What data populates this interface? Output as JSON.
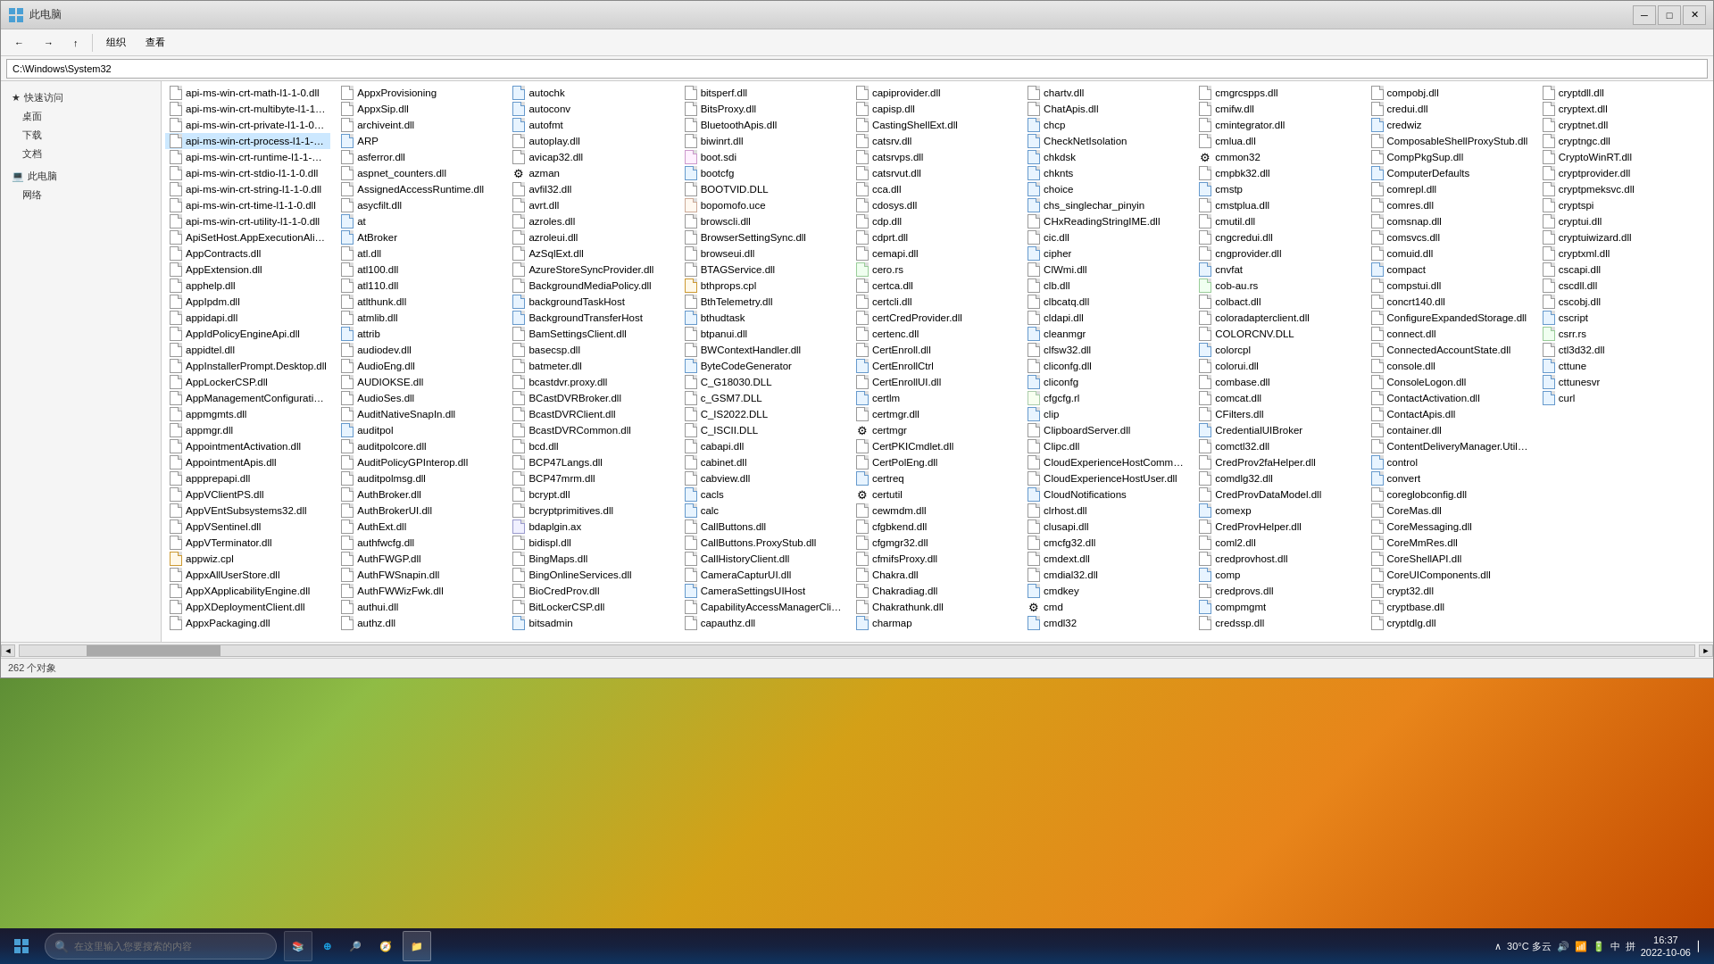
{
  "window": {
    "title": "此电脑",
    "address": "C:\\Windows\\System32"
  },
  "toolbar": {
    "back_label": "←",
    "forward_label": "→",
    "up_label": "↑",
    "view_label": "查看",
    "organize_label": "组织"
  },
  "search": {
    "placeholder": "在这里输入您要搜索的内容"
  },
  "files": [
    {
      "name": "api-ms-win-crt-math-l1-1-0.dll",
      "type": "dll"
    },
    {
      "name": "api-ms-win-crt-multibyte-l1-1-0.dll",
      "type": "dll"
    },
    {
      "name": "api-ms-win-crt-private-l1-1-0.dll",
      "type": "dll"
    },
    {
      "name": "api-ms-win-crt-process-l1-1-0.dll",
      "type": "dll",
      "selected": true
    },
    {
      "name": "api-ms-win-crt-runtime-l1-1-0.dll",
      "type": "dll"
    },
    {
      "name": "api-ms-win-crt-stdio-l1-1-0.dll",
      "type": "dll"
    },
    {
      "name": "api-ms-win-crt-string-l1-1-0.dll",
      "type": "dll"
    },
    {
      "name": "api-ms-win-crt-time-l1-1-0.dll",
      "type": "dll"
    },
    {
      "name": "api-ms-win-crt-utility-l1-1-0.dll",
      "type": "dll"
    },
    {
      "name": "ApiSetHost.AppExecutionAlias.dll",
      "type": "dll"
    },
    {
      "name": "AppContracts.dll",
      "type": "dll"
    },
    {
      "name": "AppExtension.dll",
      "type": "dll"
    },
    {
      "name": "apphelp.dll",
      "type": "dll"
    },
    {
      "name": "AppIpdm.dll",
      "type": "dll"
    },
    {
      "name": "appidapi.dll",
      "type": "dll"
    },
    {
      "name": "AppIdPolicyEngineApi.dll",
      "type": "dll"
    },
    {
      "name": "appidtel.dll",
      "type": "dll"
    },
    {
      "name": "AppInstallerPrompt.Desktop.dll",
      "type": "dll"
    },
    {
      "name": "AppLockerCSP.dll",
      "type": "dll"
    },
    {
      "name": "AppManagementConfiguration.dll",
      "type": "dll"
    },
    {
      "name": "appmgmts.dll",
      "type": "dll"
    },
    {
      "name": "appmgr.dll",
      "type": "dll"
    },
    {
      "name": "AppointmentActivation.dll",
      "type": "dll"
    },
    {
      "name": "AppointmentApis.dll",
      "type": "dll"
    },
    {
      "name": "appprepapi.dll",
      "type": "dll"
    },
    {
      "name": "AppVClientPS.dll",
      "type": "dll"
    },
    {
      "name": "AppVEntSubsystems32.dll",
      "type": "dll"
    },
    {
      "name": "AppVSentinel.dll",
      "type": "dll"
    },
    {
      "name": "AppVTerminator.dll",
      "type": "dll"
    },
    {
      "name": "appwiz.cpl",
      "type": "cpl"
    },
    {
      "name": "AppxAllUserStore.dll",
      "type": "dll"
    },
    {
      "name": "AppXApplicabilityEngine.dll",
      "type": "dll"
    },
    {
      "name": "AppXDeploymentClient.dll",
      "type": "dll"
    },
    {
      "name": "AppxPackaging.dll",
      "type": "dll"
    },
    {
      "name": "AppxProvisioning",
      "type": "dll"
    },
    {
      "name": "AppxSip.dll",
      "type": "dll"
    },
    {
      "name": "archiveint.dll",
      "type": "dll"
    },
    {
      "name": "ARP",
      "type": "exe"
    },
    {
      "name": "asferror.dll",
      "type": "dll"
    },
    {
      "name": "aspnet_counters.dll",
      "type": "dll"
    },
    {
      "name": "AssignedAccessRuntime.dll",
      "type": "dll"
    },
    {
      "name": "asycfilt.dll",
      "type": "dll"
    },
    {
      "name": "at",
      "type": "exe"
    },
    {
      "name": "AtBroker",
      "type": "exe"
    },
    {
      "name": "atl.dll",
      "type": "dll"
    },
    {
      "name": "atl100.dll",
      "type": "dll"
    },
    {
      "name": "atl110.dll",
      "type": "dll"
    },
    {
      "name": "atlthunk.dll",
      "type": "dll"
    },
    {
      "name": "atmlib.dll",
      "type": "dll"
    },
    {
      "name": "attrib",
      "type": "exe"
    },
    {
      "name": "audiodev.dll",
      "type": "dll"
    },
    {
      "name": "AudioEng.dll",
      "type": "dll"
    },
    {
      "name": "AUDIOKSE.dll",
      "type": "dll"
    },
    {
      "name": "AudioSes.dll",
      "type": "dll"
    },
    {
      "name": "AuditNativeSnapIn.dll",
      "type": "dll"
    },
    {
      "name": "auditpol",
      "type": "exe"
    },
    {
      "name": "auditpolcore.dll",
      "type": "dll"
    },
    {
      "name": "AuditPolicyGPInterop.dll",
      "type": "dll"
    },
    {
      "name": "auditpolmsg.dll",
      "type": "dll"
    },
    {
      "name": "AuthBroker.dll",
      "type": "dll"
    },
    {
      "name": "AuthBrokerUI.dll",
      "type": "dll"
    },
    {
      "name": "AuthExt.dll",
      "type": "dll"
    },
    {
      "name": "authfwcfg.dll",
      "type": "dll"
    },
    {
      "name": "AuthFWGP.dll",
      "type": "dll"
    },
    {
      "name": "AuthFWSnapin.dll",
      "type": "dll"
    },
    {
      "name": "AuthFWWizFwk.dll",
      "type": "dll"
    },
    {
      "name": "authui.dll",
      "type": "dll"
    },
    {
      "name": "authz.dll",
      "type": "dll"
    },
    {
      "name": "autochk",
      "type": "exe"
    },
    {
      "name": "autoconv",
      "type": "exe"
    },
    {
      "name": "autofmt",
      "type": "exe"
    },
    {
      "name": "autoplay.dll",
      "type": "dll"
    },
    {
      "name": "avicap32.dll",
      "type": "dll"
    },
    {
      "name": "azman",
      "type": "exe",
      "special": true
    },
    {
      "name": "avfil32.dll",
      "type": "dll"
    },
    {
      "name": "avrt.dll",
      "type": "dll"
    },
    {
      "name": "azroles.dll",
      "type": "dll"
    },
    {
      "name": "azroleui.dll",
      "type": "dll"
    },
    {
      "name": "AzSqlExt.dll",
      "type": "dll"
    },
    {
      "name": "AzureStoreSyncProvider.dll",
      "type": "dll"
    },
    {
      "name": "BackgroundMediaPolicy.dll",
      "type": "dll"
    },
    {
      "name": "backgroundTaskHost",
      "type": "exe"
    },
    {
      "name": "BackgroundTransferHost",
      "type": "exe"
    },
    {
      "name": "BamSettingsClient.dll",
      "type": "dll"
    },
    {
      "name": "basecsp.dll",
      "type": "dll"
    },
    {
      "name": "batmeter.dll",
      "type": "dll"
    },
    {
      "name": "bcastdvr.proxy.dll",
      "type": "dll"
    },
    {
      "name": "BCastDVRBroker.dll",
      "type": "dll"
    },
    {
      "name": "BcastDVRClient.dll",
      "type": "dll"
    },
    {
      "name": "BcastDVRCommon.dll",
      "type": "dll"
    },
    {
      "name": "bcd.dll",
      "type": "dll"
    },
    {
      "name": "BCP47Langs.dll",
      "type": "dll"
    },
    {
      "name": "BCP47mrm.dll",
      "type": "dll"
    },
    {
      "name": "bcrypt.dll",
      "type": "dll"
    },
    {
      "name": "bcryptprimitives.dll",
      "type": "dll"
    },
    {
      "name": "bdaplgin.ax",
      "type": "ax"
    },
    {
      "name": "bidispl.dll",
      "type": "dll"
    },
    {
      "name": "BingMaps.dll",
      "type": "dll"
    },
    {
      "name": "BingOnlineServices.dll",
      "type": "dll"
    },
    {
      "name": "BioCredProv.dll",
      "type": "dll"
    },
    {
      "name": "BitLockerCSP.dll",
      "type": "dll"
    },
    {
      "name": "bitsadmin",
      "type": "exe"
    },
    {
      "name": "bitsperf.dll",
      "type": "dll"
    },
    {
      "name": "BitsProxy.dll",
      "type": "dll"
    },
    {
      "name": "BluetoothApis.dll",
      "type": "dll"
    },
    {
      "name": "biwinrt.dll",
      "type": "dll"
    },
    {
      "name": "boot.sdi",
      "type": "sdi"
    },
    {
      "name": "bootcfg",
      "type": "exe"
    },
    {
      "name": "BOOTVID.DLL",
      "type": "dll"
    },
    {
      "name": "bopomofo.uce",
      "type": "uce"
    },
    {
      "name": "browscli.dll",
      "type": "dll"
    },
    {
      "name": "BrowserSettingSync.dll",
      "type": "dll"
    },
    {
      "name": "browseui.dll",
      "type": "dll"
    },
    {
      "name": "BTAGService.dll",
      "type": "dll"
    },
    {
      "name": "bthprops.cpl",
      "type": "cpl"
    },
    {
      "name": "BthTelemetry.dll",
      "type": "dll"
    },
    {
      "name": "bthudtask",
      "type": "exe"
    },
    {
      "name": "btpanui.dll",
      "type": "dll"
    },
    {
      "name": "BWContextHandler.dll",
      "type": "dll"
    },
    {
      "name": "ByteCodeGenerator",
      "type": "exe"
    },
    {
      "name": "C_G18030.DLL",
      "type": "dll"
    },
    {
      "name": "c_GSM7.DLL",
      "type": "dll"
    },
    {
      "name": "C_IS2022.DLL",
      "type": "dll"
    },
    {
      "name": "C_ISCII.DLL",
      "type": "dll"
    },
    {
      "name": "cabapi.dll",
      "type": "dll"
    },
    {
      "name": "cabinet.dll",
      "type": "dll"
    },
    {
      "name": "cabview.dll",
      "type": "dll"
    },
    {
      "name": "cacls",
      "type": "exe"
    },
    {
      "name": "calc",
      "type": "exe"
    },
    {
      "name": "CallButtons.dll",
      "type": "dll"
    },
    {
      "name": "CallButtons.ProxyStub.dll",
      "type": "dll"
    },
    {
      "name": "CallHistoryClient.dll",
      "type": "dll"
    },
    {
      "name": "CameraCapturUI.dll",
      "type": "dll"
    },
    {
      "name": "CameraSettingsUIHost",
      "type": "exe"
    },
    {
      "name": "CapabilityAccessManagerClient.dll",
      "type": "dll"
    },
    {
      "name": "capauthz.dll",
      "type": "dll"
    },
    {
      "name": "capiprovider.dll",
      "type": "dll"
    },
    {
      "name": "capisp.dll",
      "type": "dll"
    },
    {
      "name": "CastingShellExt.dll",
      "type": "dll"
    },
    {
      "name": "catsrv.dll",
      "type": "dll"
    },
    {
      "name": "catsrvps.dll",
      "type": "dll"
    },
    {
      "name": "catsrvut.dll",
      "type": "dll"
    },
    {
      "name": "cca.dll",
      "type": "dll"
    },
    {
      "name": "cdosys.dll",
      "type": "dll"
    },
    {
      "name": "cdp.dll",
      "type": "dll"
    },
    {
      "name": "cdprt.dll",
      "type": "dll"
    },
    {
      "name": "cemapi.dll",
      "type": "dll"
    },
    {
      "name": "cero.rs",
      "type": "rs"
    },
    {
      "name": "certca.dll",
      "type": "dll"
    },
    {
      "name": "certcli.dll",
      "type": "dll"
    },
    {
      "name": "certCredProvider.dll",
      "type": "dll"
    },
    {
      "name": "certenc.dll",
      "type": "dll"
    },
    {
      "name": "CertEnroll.dll",
      "type": "dll"
    },
    {
      "name": "CertEnrollCtrl",
      "type": "exe"
    },
    {
      "name": "CertEnrollUI.dll",
      "type": "dll"
    },
    {
      "name": "certlm",
      "type": "exe"
    },
    {
      "name": "certmgr.dll",
      "type": "dll"
    },
    {
      "name": "certmgr",
      "type": "exe",
      "special": true
    },
    {
      "name": "CertPKICmdlet.dll",
      "type": "dll"
    },
    {
      "name": "CertPolEng.dll",
      "type": "dll"
    },
    {
      "name": "certreq",
      "type": "exe"
    },
    {
      "name": "certutil",
      "type": "exe",
      "special": true
    },
    {
      "name": "cewmdm.dll",
      "type": "dll"
    },
    {
      "name": "cfgbkend.dll",
      "type": "dll"
    },
    {
      "name": "cfgmgr32.dll",
      "type": "dll"
    },
    {
      "name": "cfmifsProxy.dll",
      "type": "dll"
    },
    {
      "name": "Chakra.dll",
      "type": "dll"
    },
    {
      "name": "Chakradiag.dll",
      "type": "dll"
    },
    {
      "name": "Chakrathunk.dll",
      "type": "dll"
    },
    {
      "name": "charmap",
      "type": "exe"
    },
    {
      "name": "chartv.dll",
      "type": "dll"
    },
    {
      "name": "ChatApis.dll",
      "type": "dll"
    },
    {
      "name": "chcp",
      "type": "exe"
    },
    {
      "name": "CheckNetIsolation",
      "type": "exe"
    },
    {
      "name": "chkdsk",
      "type": "exe"
    },
    {
      "name": "chknts",
      "type": "exe"
    },
    {
      "name": "choice",
      "type": "exe"
    },
    {
      "name": "chs_singlechar_pinyin",
      "type": "exe"
    },
    {
      "name": "CHxReadingStringIME.dll",
      "type": "dll"
    },
    {
      "name": "cic.dll",
      "type": "dll"
    },
    {
      "name": "cipher",
      "type": "exe"
    },
    {
      "name": "ClWmi.dll",
      "type": "dll"
    },
    {
      "name": "clb.dll",
      "type": "dll"
    },
    {
      "name": "clbcatq.dll",
      "type": "dll"
    },
    {
      "name": "cldapi.dll",
      "type": "dll"
    },
    {
      "name": "cleanmgr",
      "type": "exe"
    },
    {
      "name": "clfsw32.dll",
      "type": "dll"
    },
    {
      "name": "cliconfg.dll",
      "type": "dll"
    },
    {
      "name": "cliconfg",
      "type": "exe"
    },
    {
      "name": "cfgcfg.rl",
      "type": "rl"
    },
    {
      "name": "clip",
      "type": "exe"
    },
    {
      "name": "ClipboardServer.dll",
      "type": "dll"
    },
    {
      "name": "Clipc.dll",
      "type": "dll"
    },
    {
      "name": "CloudExperienceHostCommon.dll",
      "type": "dll"
    },
    {
      "name": "CloudExperienceHostUser.dll",
      "type": "dll"
    },
    {
      "name": "CloudNotifications",
      "type": "exe"
    },
    {
      "name": "clrhost.dll",
      "type": "dll"
    },
    {
      "name": "clusapi.dll",
      "type": "dll"
    },
    {
      "name": "cmcfg32.dll",
      "type": "dll"
    },
    {
      "name": "cmdext.dll",
      "type": "dll"
    },
    {
      "name": "cmdial32.dll",
      "type": "dll"
    },
    {
      "name": "cmdkey",
      "type": "exe"
    },
    {
      "name": "cmd",
      "type": "exe",
      "special": true
    },
    {
      "name": "cmdl32",
      "type": "exe"
    },
    {
      "name": "cmgrcspps.dll",
      "type": "dll"
    },
    {
      "name": "cmifw.dll",
      "type": "dll"
    },
    {
      "name": "cmintegrator.dll",
      "type": "dll"
    },
    {
      "name": "cmlua.dll",
      "type": "dll"
    },
    {
      "name": "cmmon32",
      "type": "exe",
      "special": true
    },
    {
      "name": "cmpbk32.dll",
      "type": "dll"
    },
    {
      "name": "cmstp",
      "type": "exe"
    },
    {
      "name": "cmstplua.dll",
      "type": "dll"
    },
    {
      "name": "cmutil.dll",
      "type": "dll"
    },
    {
      "name": "cngcredui.dll",
      "type": "dll"
    },
    {
      "name": "cngprovider.dll",
      "type": "dll"
    },
    {
      "name": "cnvfat",
      "type": "exe"
    },
    {
      "name": "cob-au.rs",
      "type": "rs"
    },
    {
      "name": "colbact.dll",
      "type": "dll"
    },
    {
      "name": "coloradapterclient.dll",
      "type": "dll"
    },
    {
      "name": "COLORCNV.DLL",
      "type": "dll"
    },
    {
      "name": "colorcpl",
      "type": "exe"
    },
    {
      "name": "colorui.dll",
      "type": "dll"
    },
    {
      "name": "combase.dll",
      "type": "dll"
    },
    {
      "name": "comcat.dll",
      "type": "dll"
    },
    {
      "name": "CFilters.dll",
      "type": "dll"
    },
    {
      "name": "CredentialUIBroker",
      "type": "exe"
    },
    {
      "name": "comctl32.dll",
      "type": "dll"
    },
    {
      "name": "CredProv2faHelper.dll",
      "type": "dll"
    },
    {
      "name": "comdlg32.dll",
      "type": "dll"
    },
    {
      "name": "CredProvDataModel.dll",
      "type": "dll"
    },
    {
      "name": "comexp",
      "type": "exe"
    },
    {
      "name": "CredProvHelper.dll",
      "type": "dll"
    },
    {
      "name": "coml2.dll",
      "type": "dll"
    },
    {
      "name": "credprovhost.dll",
      "type": "dll"
    },
    {
      "name": "comp",
      "type": "exe"
    },
    {
      "name": "credprovs.dll",
      "type": "dll"
    },
    {
      "name": "compmgmt",
      "type": "exe"
    },
    {
      "name": "credssp.dll",
      "type": "dll"
    },
    {
      "name": "compobj.dll",
      "type": "dll"
    },
    {
      "name": "credui.dll",
      "type": "dll"
    },
    {
      "name": "credwiz",
      "type": "exe"
    },
    {
      "name": "ComposableShellProxyStub.dll",
      "type": "dll"
    },
    {
      "name": "CompPkgSup.dll",
      "type": "dll"
    },
    {
      "name": "ComputerDefaults",
      "type": "exe"
    },
    {
      "name": "comrepl.dll",
      "type": "dll"
    },
    {
      "name": "comres.dll",
      "type": "dll"
    },
    {
      "name": "comsnap.dll",
      "type": "dll"
    },
    {
      "name": "comsvcs.dll",
      "type": "dll"
    },
    {
      "name": "comuid.dll",
      "type": "dll"
    },
    {
      "name": "compact",
      "type": "exe"
    },
    {
      "name": "compstui.dll",
      "type": "dll"
    },
    {
      "name": "concrt140.dll",
      "type": "dll"
    },
    {
      "name": "ConfigureExpandedStorage.dll",
      "type": "dll"
    },
    {
      "name": "connect.dll",
      "type": "dll"
    },
    {
      "name": "ConnectedAccountState.dll",
      "type": "dll"
    },
    {
      "name": "console.dll",
      "type": "dll"
    },
    {
      "name": "ConsoleLogon.dll",
      "type": "dll"
    },
    {
      "name": "ContactActivation.dll",
      "type": "dll"
    },
    {
      "name": "ContactApis.dll",
      "type": "dll"
    },
    {
      "name": "container.dll",
      "type": "dll"
    },
    {
      "name": "ContentDeliveryManager.Utilities.dll",
      "type": "dll"
    },
    {
      "name": "control",
      "type": "exe"
    },
    {
      "name": "convert",
      "type": "exe"
    },
    {
      "name": "coreglobconfig.dll",
      "type": "dll"
    },
    {
      "name": "CoreMas.dll",
      "type": "dll"
    },
    {
      "name": "CoreMessaging.dll",
      "type": "dll"
    },
    {
      "name": "CoreMmRes.dll",
      "type": "dll"
    },
    {
      "name": "CoreShellAPI.dll",
      "type": "dll"
    },
    {
      "name": "CoreUIComponents.dll",
      "type": "dll"
    },
    {
      "name": "crypt32.dll",
      "type": "dll"
    },
    {
      "name": "cryptbase.dll",
      "type": "dll"
    },
    {
      "name": "cryptdlg.dll",
      "type": "dll"
    },
    {
      "name": "cryptdll.dll",
      "type": "dll"
    },
    {
      "name": "cryptext.dll",
      "type": "dll"
    },
    {
      "name": "cryptnet.dll",
      "type": "dll"
    },
    {
      "name": "cryptngc.dll",
      "type": "dll"
    },
    {
      "name": "CryptoWinRT.dll",
      "type": "dll"
    },
    {
      "name": "cryptprovider.dll",
      "type": "dll"
    },
    {
      "name": "cryptpmeksvc.dll",
      "type": "dll"
    },
    {
      "name": "cryptspi",
      "type": "dll"
    },
    {
      "name": "cryptui.dll",
      "type": "dll"
    },
    {
      "name": "cryptuiwizard.dll",
      "type": "dll"
    },
    {
      "name": "cryptxml.dll",
      "type": "dll"
    },
    {
      "name": "cscapi.dll",
      "type": "dll"
    },
    {
      "name": "cscdll.dll",
      "type": "dll"
    },
    {
      "name": "cscobj.dll",
      "type": "dll"
    },
    {
      "name": "cscript",
      "type": "exe"
    },
    {
      "name": "csrr.rs",
      "type": "rs"
    },
    {
      "name": "ctl3d32.dll",
      "type": "dll"
    },
    {
      "name": "cttune",
      "type": "exe"
    },
    {
      "name": "cttunesvr",
      "type": "exe"
    },
    {
      "name": "curl",
      "type": "exe"
    }
  ],
  "status_bar": {
    "text": "262 个对象"
  },
  "taskbar": {
    "search_placeholder": "在这里输入您要搜索的内容",
    "time": "16:37",
    "date": "2022-10-06",
    "weather": "30°C 多云",
    "items": [
      {
        "label": "此电脑",
        "active": true
      }
    ]
  },
  "colors": {
    "accent": "#0078d4",
    "selected_bg": "#cce8ff",
    "taskbar_bg": "#1a1a2e"
  }
}
